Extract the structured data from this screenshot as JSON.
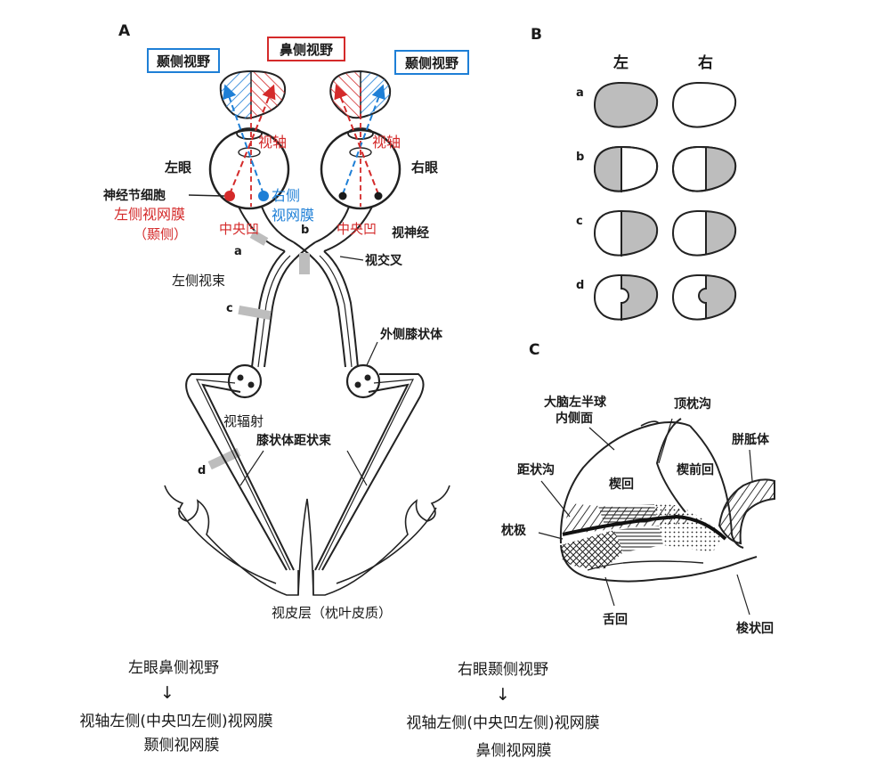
{
  "panel_a": {
    "letter": "A",
    "temporal_field_left": "颞侧视野",
    "nasal_field": "鼻侧视野",
    "temporal_field_right": "颞侧视野",
    "visual_axis_left": "视轴",
    "visual_axis_right": "视轴",
    "left_eye": "左眼",
    "right_eye": "右眼",
    "ganglion_cell": "神经节细胞",
    "right_retina_1": "右侧",
    "right_retina_2": "视网膜",
    "left_retina_1": "左侧视网膜",
    "left_retina_2": "（颞侧）",
    "fovea_left": "中央凹",
    "fovea_right": "中央凹",
    "optic_nerve": "视神经",
    "chiasm": "视交叉",
    "optic_tract": "左侧视束",
    "lgn": "外侧膝状体",
    "radiation": "视辐射",
    "geniculocalcarine": "膝状体距状束",
    "cortex": "视皮层（枕叶皮质）",
    "lesion_a": "a",
    "lesion_b": "b",
    "lesion_c": "c",
    "lesion_d": "d"
  },
  "panel_b": {
    "letter": "B",
    "left": "左",
    "right": "右",
    "rows": [
      "a",
      "b",
      "c",
      "d"
    ]
  },
  "panel_c": {
    "letter": "C",
    "hemisphere_1": "大脑左半球",
    "hemisphere_2": "内侧面",
    "parieto_occipital": "顶枕沟",
    "corpus_callosum": "胼胝体",
    "cuneus": "楔回",
    "precuneus": "楔前回",
    "calcarine": "距状沟",
    "occipital_pole": "枕极",
    "lingual": "舌回",
    "fusiform": "梭状回"
  },
  "notes": {
    "left_title": "左眼鼻侧视野",
    "left_arrow": "↓",
    "left_line1": "视轴左侧(中央凹左侧)视网膜",
    "left_line2": "颞侧视网膜",
    "right_title": "右眼颞侧视野",
    "right_arrow": "↓",
    "right_line1": "视轴左侧(中央凹左侧)视网膜",
    "right_line2": "鼻侧视网膜"
  },
  "colors": {
    "red": "#d42a2a",
    "blue": "#1e7fd6",
    "shade": "#bdbdbd",
    "ink": "#1a1a1a"
  }
}
